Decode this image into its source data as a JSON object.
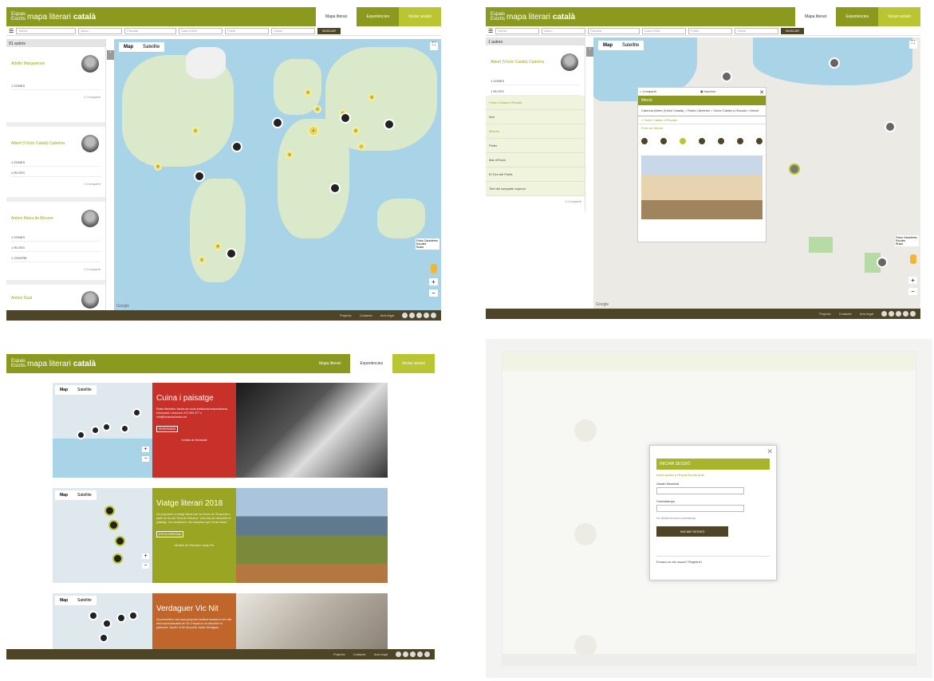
{
  "app": {
    "logo_text": "Espais Escrits",
    "brand_light": "mapa literari",
    "brand_bold": "català",
    "tabs": [
      "Mapa literari",
      "Experiències",
      "Iniciar sessió"
    ]
  },
  "search": {
    "fields": [
      "Sense",
      "Autor...",
      "Paraula",
      "Data d'inici",
      "Poble",
      "Ciutat"
    ],
    "button": "BUSCAR"
  },
  "panel1": {
    "sidebar_header": "91 autors",
    "authors": [
      {
        "name": "Adolfo Margarense",
        "rows": [
          "1  ZONES"
        ],
        "more": "1 Compartir"
      },
      {
        "name": "Albert (Víctor Català) Caterina",
        "rows": [
          "1  ZONES",
          "1  RUTES"
        ],
        "more": "1 Compartir"
      },
      {
        "name": "Antoni Maria de Alcover",
        "rows": [
          "1  ZONES",
          "1  RUTES",
          "1  CENTRE"
        ],
        "more": "1 Compartir"
      },
      {
        "name": "Antoni Gual",
        "rows": [],
        "more": ""
      }
    ],
    "map_tabs": [
      "Map",
      "Satellite"
    ],
    "clusters": [
      "4",
      "4",
      "8",
      "11",
      "8",
      "4",
      "7",
      "5",
      "2",
      "5",
      "3",
      "2"
    ],
    "layer_labels": [
      "Fotos Caracteres",
      "Escoles",
      "Rutes"
    ],
    "attribution": "Google"
  },
  "panel2": {
    "sidebar_header": "1 autors",
    "author_name": "Albert (Víctor Català) Caterina",
    "rows": [
      "1  ZONES",
      "1  RUTES"
    ],
    "route_title": "Víctor Català a l'Escala",
    "route_items": [
      "Inici",
      "Mercès",
      "Pórtic",
      "Mar d'Encís",
      "El Cim del Poble",
      "Text del compartir suprem"
    ],
    "more": "1 Compartir",
    "popup": {
      "toolbar_left": "Compartir",
      "toolbar_mid": "Imprimir",
      "title": "Mercè",
      "breadcrumb": "Caterina Albert (Víctor Català) > Rutes Literàries > Víctor Català a l'Escala > Mercè",
      "route_link": "« Víctor Català a l'Escala",
      "step_label": "Punt de: Mercè",
      "steps": [
        "1",
        "2",
        "3",
        "4",
        "5",
        "6",
        "7"
      ],
      "current_step_index": 2
    },
    "map_tabs": [
      "Map",
      "Satellite"
    ],
    "layer_labels": [
      "Fotos Caracteres",
      "Escoles",
      "Rutes"
    ],
    "attribution": "Google"
  },
  "panel3": {
    "experiences": [
      {
        "title": "Cuina i paisatge",
        "desc": "Rutes literàries i tastos de cuina tradicional empordanesa. Informació i reserves: 972 000 377 o info@fundaciovisoes.cat",
        "link": "RESERVARS",
        "caption": "Cedida de Montsaldi",
        "color": "#c8302a"
      },
      {
        "title": "Viatge literari 2018",
        "desc": "Us proposem un viatge literari per les terres de l'Empordà a partir de la ruta 'Terra de Petrarca'. Una ruta per descobrir el paisatge, les escriptores i els escriptors que hi han viscut.",
        "link": "ESTIU ESPECIAL",
        "caption": "Mirades de l'escriptor Josep Pla",
        "color": "#9aa524"
      },
      {
        "title": "Verdaguer Vic Nit",
        "desc": "Us presentem una nova proposta turística basada en les nits més impressionants de Vic i l'espai on va descobrir el patrimoni. Jacint i el bé del poeta Jacint Verdaguer.",
        "link": "",
        "caption": "",
        "color": "#c0662b"
      }
    ],
    "map_tabs": [
      "Map",
      "Satellite"
    ]
  },
  "panel4": {
    "login": {
      "title": "INICIAR SESSIÓ",
      "subtitle": "Inicia sessió a l'Espai Escrits amb",
      "user_label": "Usuari Nacional",
      "pass_label": "Contrasenya",
      "forgot": "He oblidat la meva contrasenya",
      "button": "INICIAR SESSIÓ",
      "register": "Encara no ets usuari? Registra't"
    }
  },
  "footer": {
    "links": [
      "Projecte",
      "Contacte",
      "Avís legal"
    ]
  },
  "colors": {
    "brand_green": "#8b9a1f",
    "lime": "#b9c531",
    "dark_footer": "#4e4526"
  }
}
